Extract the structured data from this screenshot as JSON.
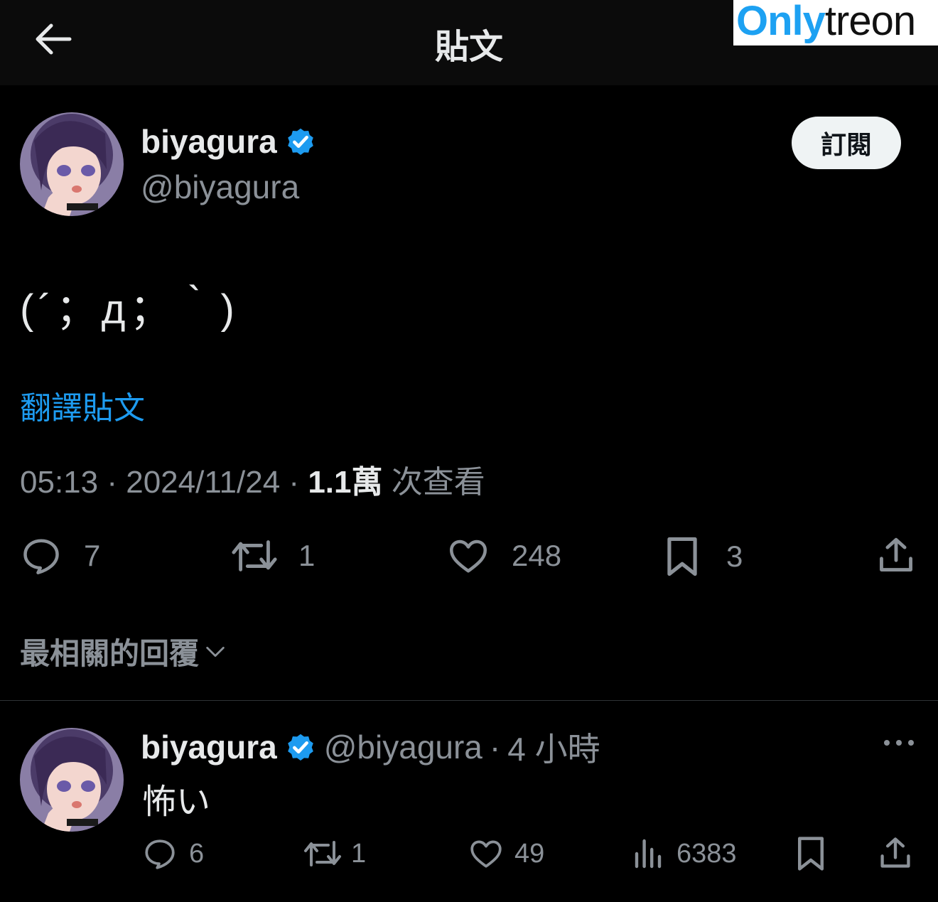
{
  "header": {
    "title": "貼文",
    "back_icon": "arrow-left-icon"
  },
  "watermark": {
    "part1": "Only",
    "part2": "treon"
  },
  "post": {
    "author_name": "biyagura",
    "author_handle": "@biyagura",
    "subscribe_label": "訂閱",
    "text": "(´；д；｀)",
    "translate_label": "翻譯貼文",
    "time": "05:13",
    "date": "2024/11/24",
    "views_count": "1.1萬",
    "views_label": "次查看",
    "separator": "·",
    "actions": {
      "reply_count": "7",
      "repost_count": "1",
      "like_count": "248",
      "bookmark_count": "3"
    }
  },
  "sort": {
    "label": "最相關的回覆"
  },
  "reply": {
    "author_name": "biyagura",
    "author_handle": "@biyagura",
    "separator": "·",
    "time_ago": "4 小時",
    "text": "怖い",
    "actions": {
      "reply_count": "6",
      "repost_count": "1",
      "like_count": "49",
      "views_count": "6383"
    }
  },
  "colors": {
    "background": "#000000",
    "accent": "#1d9bf0",
    "muted": "#8b9198",
    "text": "#e7e9ea"
  }
}
